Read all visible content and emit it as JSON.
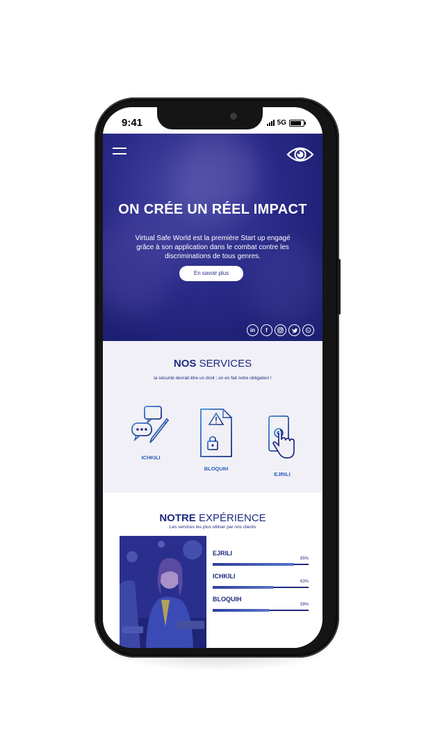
{
  "status_bar": {
    "time": "9:41",
    "network": "5G"
  },
  "hero": {
    "title": "ON CRÉE UN RÉEL IMPACT",
    "description": "Virtual Safe World est la première Start up engagé grâce à son application dans le combat contre les discriminations de tous genres.",
    "cta_label": "En savoir plus",
    "socials": [
      "linkedin-icon",
      "facebook-icon",
      "instagram-icon",
      "twitter-icon",
      "whatsapp-icon"
    ]
  },
  "services": {
    "title_bold": "NOS",
    "title_light": "SERVICES",
    "subtitle": "la sécurité devrait être un droit ; on en fait notre obligation !",
    "items": [
      {
        "label": "ICHKILI",
        "icon": "chat-pencil-icon"
      },
      {
        "label": "BLOQUIH",
        "icon": "locked-document-icon"
      },
      {
        "label": "EJRILI",
        "icon": "touch-phone-icon"
      }
    ]
  },
  "experience": {
    "title_bold": "NOTRE",
    "title_light": "EXPÉRIENCE",
    "subtitle": "Les services les plus utiliser par nos clients",
    "stats": [
      {
        "label": "EJRILI",
        "percent_label": "85%",
        "value": 0.85
      },
      {
        "label": "ICHKILI",
        "percent_label": "63%",
        "value": 0.63
      },
      {
        "label": "BLOQUIH",
        "percent_label": "59%",
        "value": 0.59
      }
    ]
  },
  "colors": {
    "primary": "#1e2a80",
    "accent": "#2d5fb8",
    "hero_bg": "#1f2177"
  }
}
